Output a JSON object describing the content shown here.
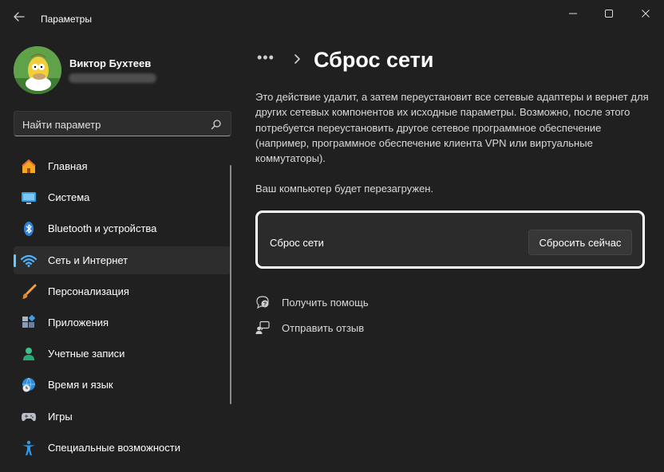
{
  "window": {
    "title": "Параметры",
    "controls": {
      "minimize": "minimize-icon",
      "maximize": "maximize-icon",
      "close": "close-icon"
    }
  },
  "user": {
    "name": "Виктор Бухтеев"
  },
  "search": {
    "placeholder": "Найти параметр"
  },
  "sidebar": {
    "items": [
      {
        "label": "Главная",
        "icon": "home-icon"
      },
      {
        "label": "Система",
        "icon": "monitor-icon"
      },
      {
        "label": "Bluetooth и устройства",
        "icon": "bluetooth-icon"
      },
      {
        "label": "Сеть и Интернет",
        "icon": "wifi-icon",
        "active": true
      },
      {
        "label": "Персонализация",
        "icon": "brush-icon"
      },
      {
        "label": "Приложения",
        "icon": "apps-icon"
      },
      {
        "label": "Учетные записи",
        "icon": "person-icon"
      },
      {
        "label": "Время и язык",
        "icon": "globe-clock-icon"
      },
      {
        "label": "Игры",
        "icon": "gamepad-icon"
      },
      {
        "label": "Специальные возможности",
        "icon": "accessibility-icon"
      }
    ]
  },
  "breadcrumb": {
    "ellipsis": "•••"
  },
  "page": {
    "title": "Сброс сети",
    "description": "Это действие удалит, а затем переустановит все сетевые адаптеры и вернет для других сетевых компонентов их исходные параметры. Возможно, после этого потребуется переустановить другое сетевое программное обеспечение (например, программное обеспечение клиента VPN или виртуальные коммутаторы).",
    "restart_note": "Ваш компьютер будет перезагружен.",
    "card": {
      "label": "Сброс сети",
      "button": "Сбросить сейчас"
    },
    "links": [
      {
        "label": "Получить помощь",
        "icon": "help-icon"
      },
      {
        "label": "Отправить отзыв",
        "icon": "feedback-icon"
      }
    ]
  },
  "colors": {
    "background": "#202020",
    "accent": "#60cdff",
    "card": "#2b2b2b",
    "highlight_border": "#ffffff"
  }
}
